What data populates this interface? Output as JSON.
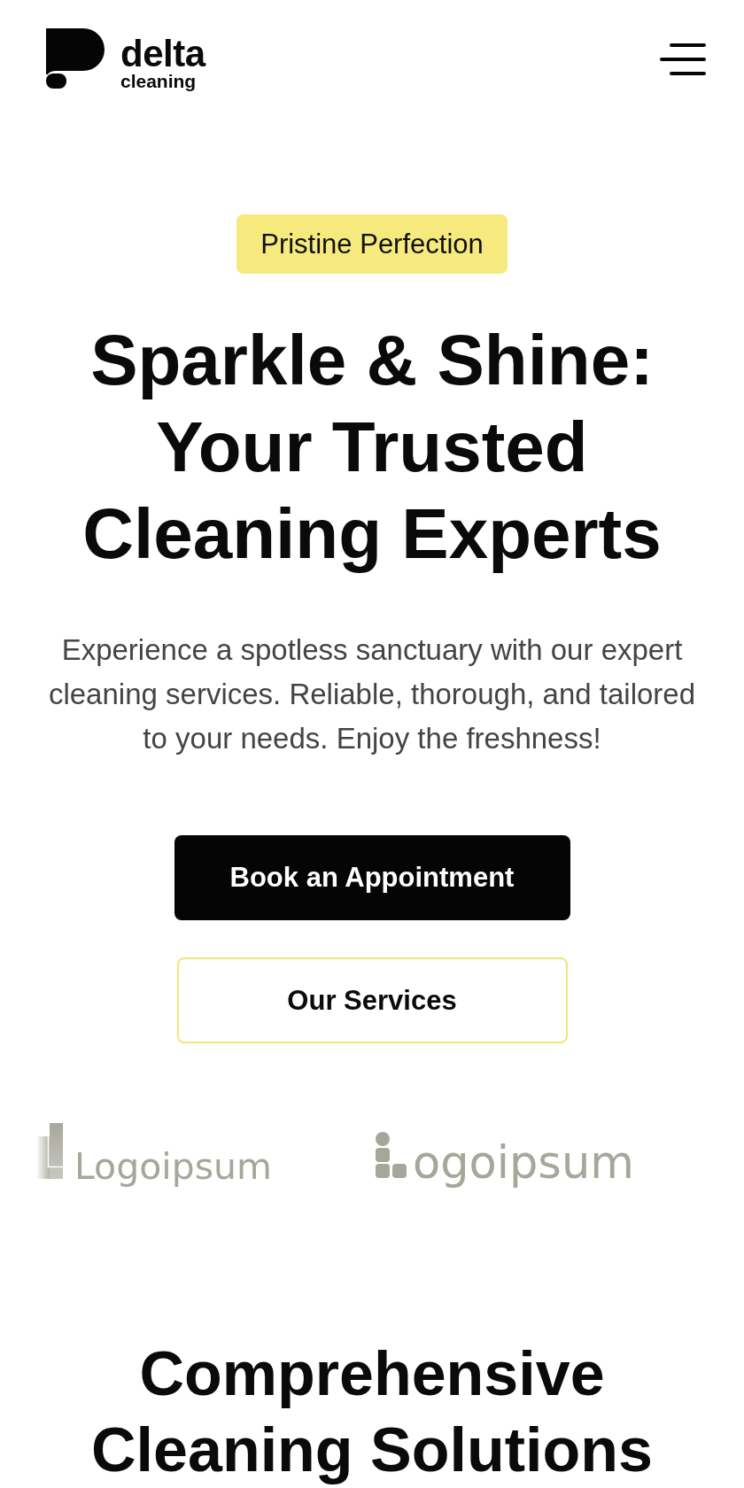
{
  "header": {
    "brand": {
      "name": "delta",
      "tagline": "cleaning"
    }
  },
  "hero": {
    "badge": "Pristine Perfection",
    "title": "Sparkle & Shine: Your Trusted Cleaning Experts",
    "description": "Experience a spotless sanctuary with our expert cleaning services. Reliable, thorough, and tailored to your needs. Enjoy the freshness!",
    "buttons": [
      {
        "label": "Book an Appointment",
        "kind": "primary"
      },
      {
        "label": "Our Services",
        "kind": "outline"
      }
    ]
  },
  "partner_logos": [
    {
      "kind": "bars",
      "wordmark": "Logoipsum"
    },
    {
      "kind": "blocks",
      "wordmark": "ogoipsum"
    }
  ],
  "services": {
    "title": "Comprehensive Cleaning Solutions"
  }
}
